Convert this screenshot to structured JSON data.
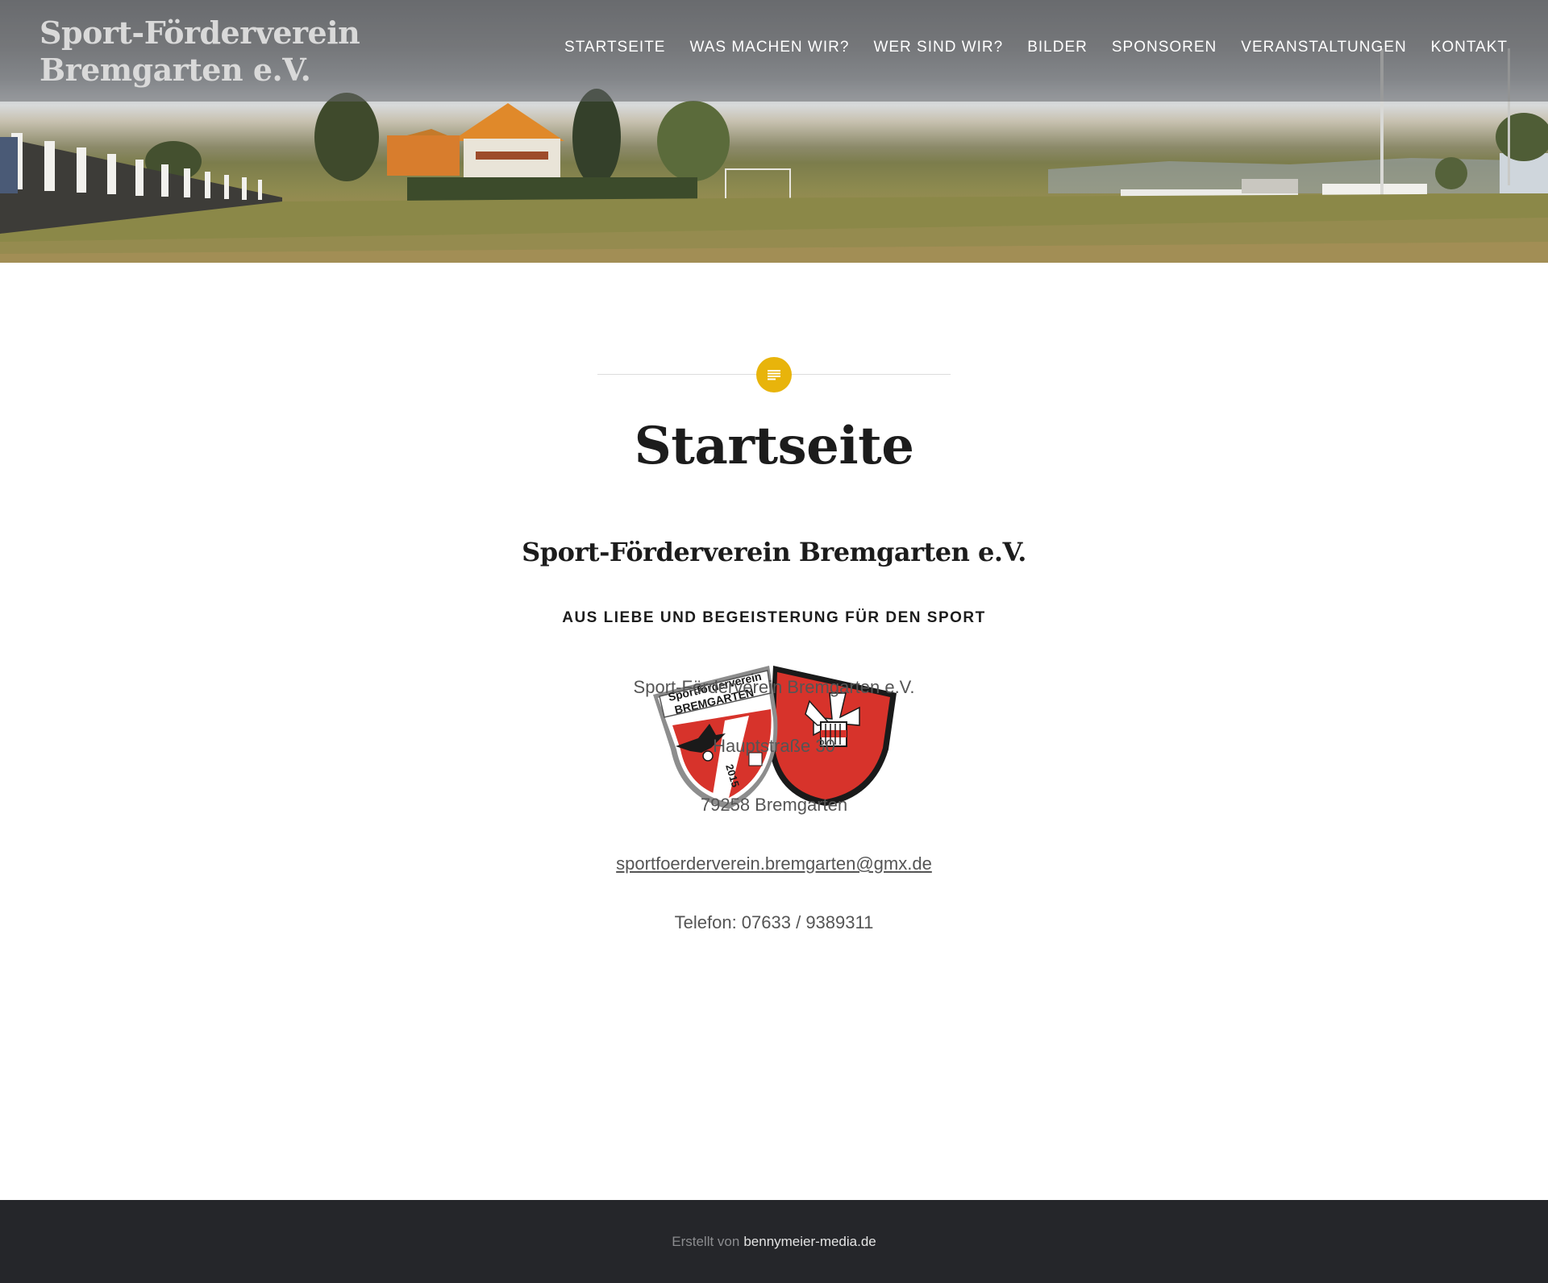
{
  "header": {
    "site_title": "Sport-Förderverein Bremgarten e.V.",
    "nav": [
      {
        "label": "STARTSEITE"
      },
      {
        "label": "WAS MACHEN WIR?"
      },
      {
        "label": "WER SIND WIR?"
      },
      {
        "label": "BILDER"
      },
      {
        "label": "SPONSOREN"
      },
      {
        "label": "VERANSTALTUNGEN"
      },
      {
        "label": "KONTAKT"
      }
    ]
  },
  "main": {
    "page_icon": "document-icon",
    "title": "Startseite",
    "subheading": "Sport-Förderverein Bremgarten e.V.",
    "tagline": "AUS LIEBE UND BEGEISTERUNG FÜR DEN SPORT",
    "logo": {
      "crest_text_top": "Sportförderverein",
      "crest_text_name": "BREMGARTEN",
      "crest_year": "2015"
    },
    "contact": {
      "name": "Sport-Förderverein Bremgarten e.V.",
      "street": "Hauptstraße 30",
      "city": "79258 Bremgarten",
      "email": "sportfoerderverein.bremgarten@gmx.de",
      "phone": "Telefon: 07633 / 9389311"
    }
  },
  "footer": {
    "prefix": "Erstellt von",
    "link": "bennymeier-media.de"
  },
  "colors": {
    "accent": "#e8b40b",
    "footer_bg": "#25262a",
    "crest_red": "#d7332b"
  }
}
